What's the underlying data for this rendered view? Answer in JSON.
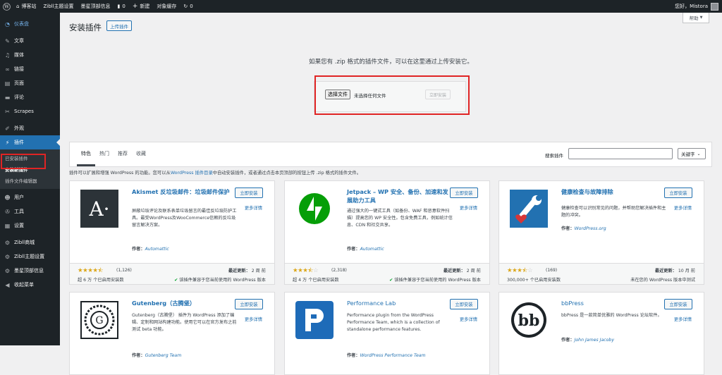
{
  "adminbar": {
    "site_name": "博客站",
    "zibll_theme": "Zibll主题设置",
    "moxing": "墨星顶部信息",
    "comments_count": "0",
    "new_label": "新建",
    "object_cache": "对象缓存",
    "updates_count": "0",
    "greeting": "您好，Mistora"
  },
  "sidebar": {
    "dashboard": "仪表盘",
    "posts": "文章",
    "media": "媒体",
    "links": "链接",
    "pages": "页面",
    "comments": "评论",
    "scrapes": "Scrapes",
    "appearance": "外观",
    "plugins": "插件",
    "sub_installed": "已安装插件",
    "sub_add_new": "安装新插件",
    "sub_editor": "插件文件编辑器",
    "users": "用户",
    "tools": "工具",
    "settings": "设置",
    "zibll_mall": "Zibll商城",
    "zibll_settings": "Zibll主题设置",
    "moxing_info": "墨星顶部信息",
    "collapse": "收起菜单"
  },
  "header": {
    "help": "帮助",
    "title": "安装插件",
    "upload_button": "上传插件"
  },
  "upload": {
    "hint": "如果您有 .zip 格式的插件文件，可以在这里通过上传安装它。",
    "choose_file": "选择文件",
    "no_file": "未选择任何文件",
    "install_now": "立即安装"
  },
  "filter": {
    "tabs": [
      "特色",
      "热门",
      "推荐",
      "收藏"
    ],
    "search_label": "搜索插件",
    "search_value": "",
    "search_type": "关键字"
  },
  "intro": {
    "before": "插件可以扩展和增强 WordPress 的功能。您可以从",
    "link": "WordPress 插件目录",
    "after": "中自动安装插件，或者通过点击本页顶部的按钮上传 .zip 格式的插件文件。"
  },
  "cards": [
    {
      "name": "Akismet 反垃圾邮件：垃圾邮件保护",
      "desc": "屏蔽垃圾评论及联系表单垃圾留言的最佳反垃圾防护工具。最受WordPress及WooCommerce信赖的反垃圾留言解决方案。",
      "author_label": "作者：",
      "author": "Automattic",
      "install": "立即安装",
      "more": "更多详情",
      "rating": 4.5,
      "rating_count": "(1,126)",
      "installs": "超 6 万 个已启用安装数",
      "updated_label": "最近更新：",
      "updated": "2 周 前",
      "compat": "该插件兼容于您当前使用的 WordPress 版本",
      "icon": "akismet-icon"
    },
    {
      "name": "Jetpack – WP 安全、备份、加速和发展助力工具",
      "desc": "通过强大的一键式工具（如备份、WAF 和恶意软件扫描）提高您的 WP 安全性。包含免费工具，例如统计信息、CDN 和社交共享。",
      "author_label": "作者：",
      "author": "Automattic",
      "install": "立即安装",
      "more": "更多详情",
      "rating": 3.5,
      "rating_count": "(2,318)",
      "installs": "超 4 万 个已启用安装数",
      "updated_label": "最近更新：",
      "updated": "2 周 前",
      "compat": "该插件兼容于您当前使用的 WordPress 版本",
      "icon": "jetpack-icon"
    },
    {
      "name": "健康检查与故障排除",
      "desc": "健康检查可以识别常见的问题，并帮助您解决插件和主题的冲突。",
      "author_label": "作者：",
      "author": "WordPress.org",
      "install": "立即安装",
      "more": "更多详情",
      "rating": 3.5,
      "rating_count": "(169)",
      "installs": "300,000+ 个已启用安装数",
      "updated_label": "最近更新：",
      "updated": "10 月 前",
      "compat": "未在您的 WordPress 版本中测试",
      "icon": "health-check-icon"
    },
    {
      "name": "Gutenberg（古腾堡）",
      "desc": "Gutenberg（古腾堡） 插件为 WordPress 添加了编辑、定制和网站构建功能。使用它可以在官方发布之前测试 beta 功能。",
      "author_label": "作者：",
      "author": "Gutenberg Team",
      "install": "立即安装",
      "more": "更多详情",
      "icon": "gutenberg-icon"
    },
    {
      "name": "Performance Lab",
      "desc": "Performance plugin from the WordPress Performance Team, which is a collection of standalone performance features.",
      "author_label": "作者：",
      "author": "WordPress Performance Team",
      "install": "立即安装",
      "more": "更多详情",
      "icon": "performance-lab-icon"
    },
    {
      "name": "bbPress",
      "desc": "bbPress 是一款简单优雅的 WordPress 论坛软件。",
      "author_label": "作者：",
      "author": "John James Jacoby",
      "install": "立即安装",
      "more": "更多详情",
      "icon": "bbpress-icon"
    }
  ]
}
